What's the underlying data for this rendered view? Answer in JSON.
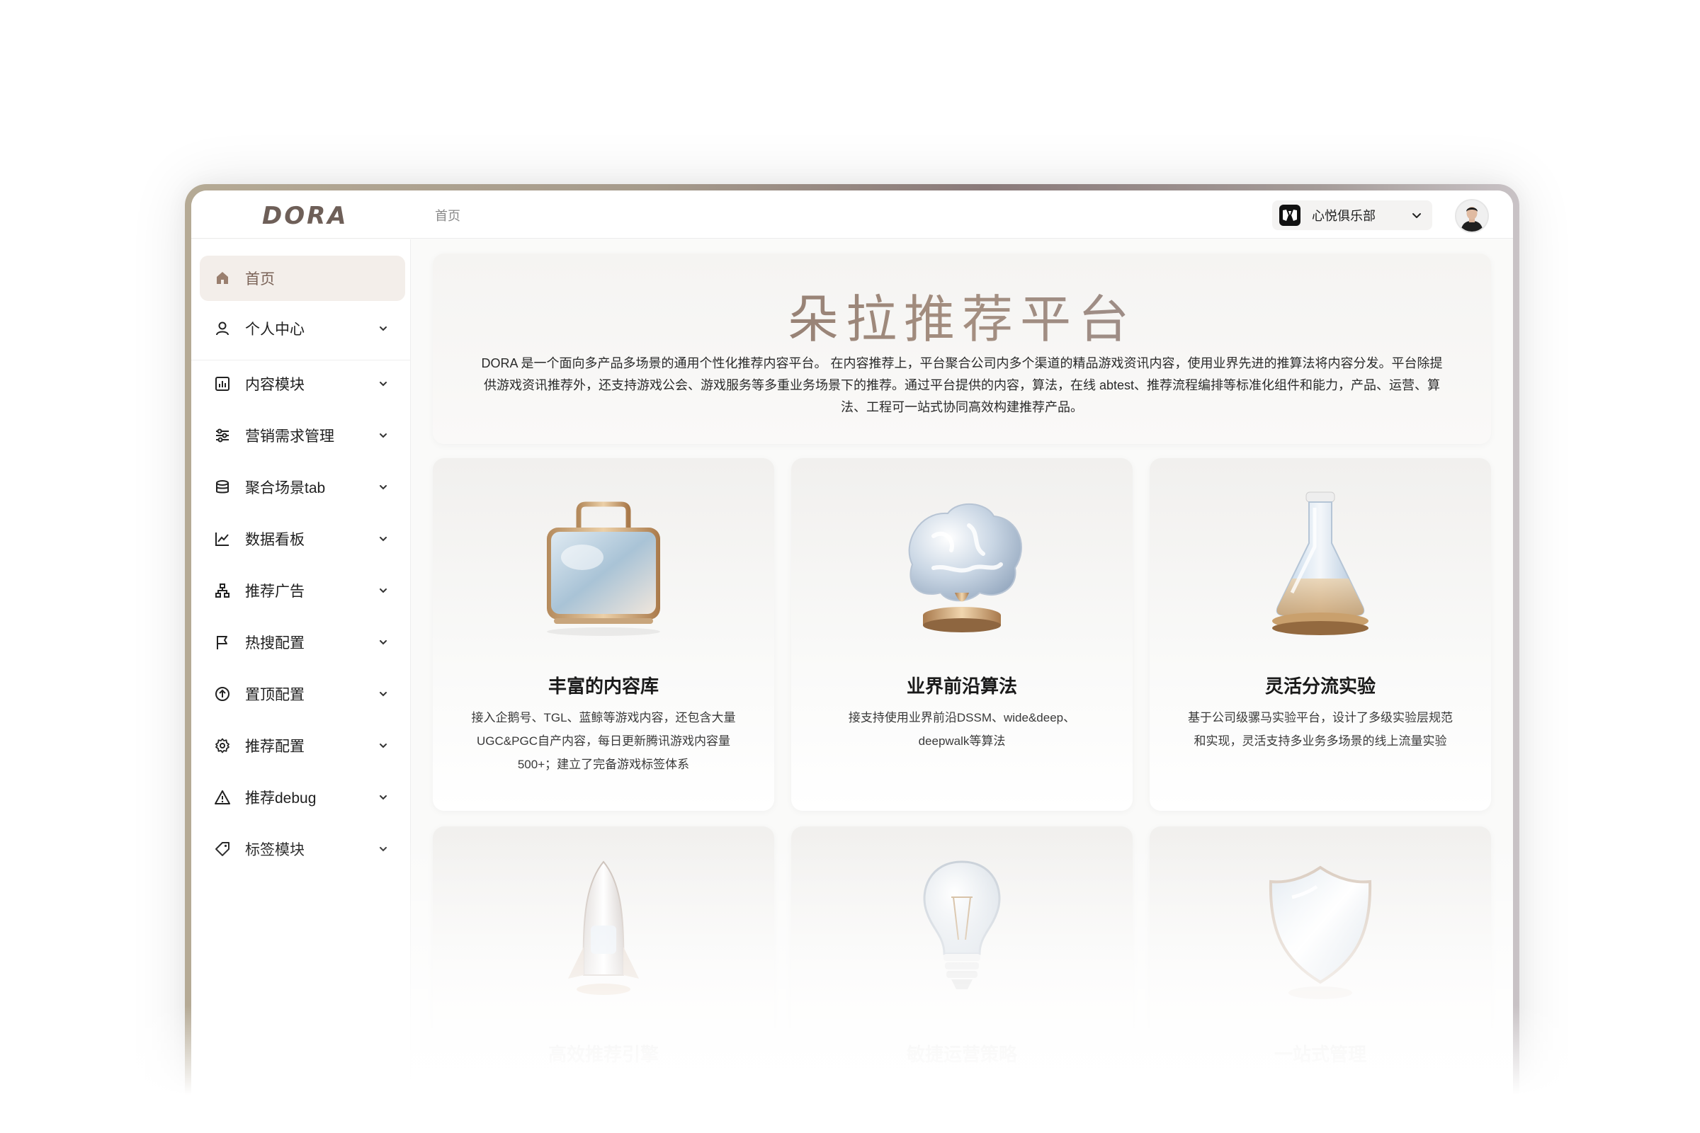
{
  "app": {
    "logo": "DORA",
    "breadcrumb": "首页",
    "org": {
      "name": "心悦俱乐部",
      "logo_icon": "club-logo-icon"
    },
    "avatar_icon": "user-avatar"
  },
  "sidebar": {
    "items": [
      {
        "label": "首页",
        "icon": "home-icon",
        "active": true
      },
      {
        "label": "个人中心",
        "icon": "user-icon"
      },
      {
        "label": "内容模块",
        "icon": "bar-chart-icon"
      },
      {
        "label": "营销需求管理",
        "icon": "sliders-icon"
      },
      {
        "label": "聚合场景tab",
        "icon": "database-icon"
      },
      {
        "label": "数据看板",
        "icon": "line-chart-icon"
      },
      {
        "label": "推荐广告",
        "icon": "hierarchy-icon"
      },
      {
        "label": "热搜配置",
        "icon": "flag-icon"
      },
      {
        "label": "置顶配置",
        "icon": "arrow-up-circle-icon"
      },
      {
        "label": "推荐配置",
        "icon": "gear-icon"
      },
      {
        "label": "推荐debug",
        "icon": "warning-icon"
      },
      {
        "label": "标签模块",
        "icon": "tag-icon"
      }
    ]
  },
  "hero": {
    "title": "朵拉推荐平台",
    "description": "DORA 是一个面向多产品多场景的通用个性化推荐内容平台。 在内容推荐上，平台聚合公司内多个渠道的精品游戏资讯内容，使用业界先进的推算法将内容分发。平台除提供游戏资讯推荐外，还支持游戏公会、游戏服务等多重业务场景下的推荐。通过平台提供的内容，算法，在线 abtest、推荐流程编排等标准化组件和能力，产品、运营、算法、工程可一站式协同高效构建推荐产品。"
  },
  "cards": [
    {
      "title": "丰富的内容库",
      "desc": "接入企鹅号、TGL、蓝鲸等游戏内容，还包含大量UGC&PGC自产内容，每日更新腾讯游戏内容量500+；建立了完备游戏标签体系",
      "icon": "briefcase-icon"
    },
    {
      "title": "业界前沿算法",
      "desc": "接支持使用业界前沿DSSM、wide&deep、deepwalk等算法",
      "icon": "brain-icon"
    },
    {
      "title": "灵活分流实验",
      "desc": "基于公司级骡马实验平台，设计了多级实验层规范和实现，灵活支持多业务多场景的线上流量实验",
      "icon": "flask-icon"
    },
    {
      "title": "高效推荐引擎",
      "desc": "",
      "icon": "rocket-icon"
    },
    {
      "title": "敏捷运营策略",
      "desc": "",
      "icon": "lightbulb-icon"
    },
    {
      "title": "一站式管理",
      "desc": "",
      "icon": "shield-icon"
    }
  ],
  "colors": {
    "accent": "#7a6358",
    "active_bg": "#f3eeea",
    "frame_gradient": [
      "#b5aa95",
      "#8a7a7a",
      "#c9c3c6"
    ]
  }
}
